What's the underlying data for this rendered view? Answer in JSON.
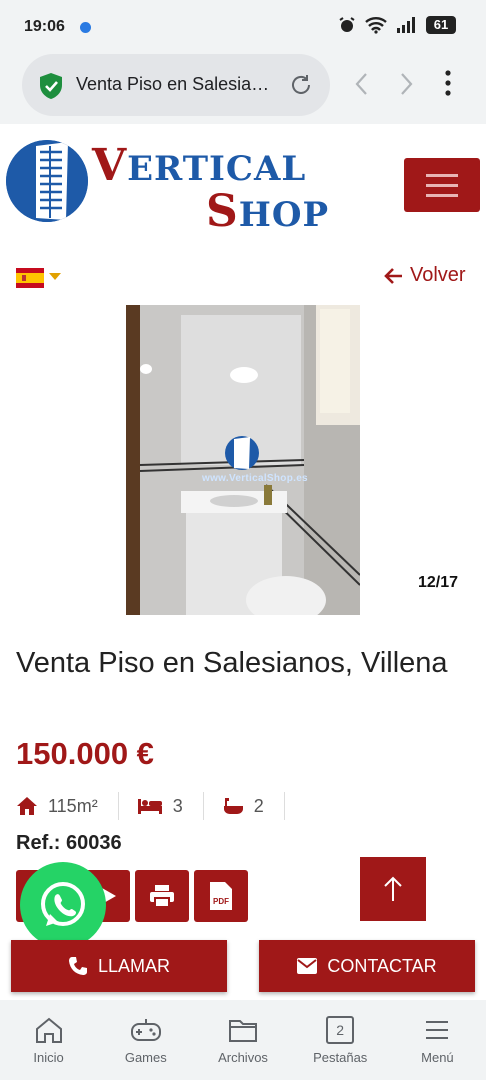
{
  "status_bar": {
    "time": "19:06",
    "battery": "61"
  },
  "browser": {
    "url_title": "Venta Piso en Salesia…"
  },
  "brand": {
    "line1_first": "V",
    "line1_rest": "ERTICAL",
    "line2_first": "S",
    "line2_rest": "HOP"
  },
  "nav": {
    "back_label": "Volver"
  },
  "gallery": {
    "counter": "12/17",
    "watermark": "www.VerticalShop.es"
  },
  "listing": {
    "title": "Venta Piso en Salesianos, Villena",
    "price": "150.000 €",
    "area": "115m²",
    "bedrooms": "3",
    "bathrooms": "2",
    "ref": "Ref.: 60036"
  },
  "actions": {
    "call_label": "LLAMAR",
    "contact_label": "CONTACTAR",
    "pdf_label": "PDF"
  },
  "bottom_nav": [
    {
      "label": "Inicio",
      "icon": "home-icon"
    },
    {
      "label": "Games",
      "icon": "gamepad-icon"
    },
    {
      "label": "Archivos",
      "icon": "folder-icon"
    },
    {
      "label": "Pestañas",
      "icon": "tabs-icon",
      "count": "2"
    },
    {
      "label": "Menú",
      "icon": "menu-icon"
    }
  ],
  "colors": {
    "accent": "#a01818",
    "brand_blue": "#1e5aa8",
    "whatsapp": "#25d366"
  }
}
